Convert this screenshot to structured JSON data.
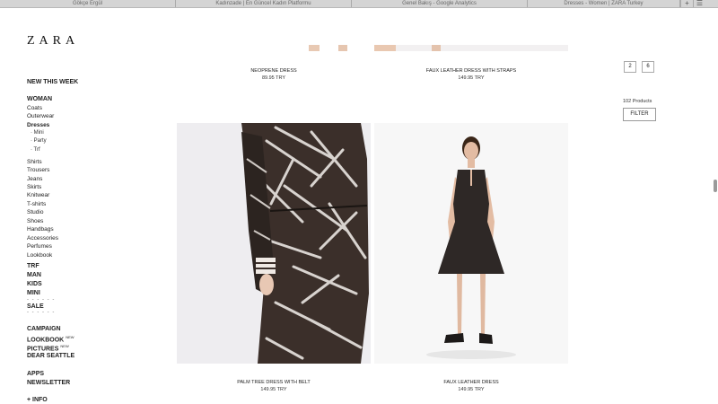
{
  "browser": {
    "tabs": [
      "Gökçe Ergül",
      "Kadınzade | En Güncel Kadın Platformu",
      "Genel Bakış - Google Analytics",
      "Dresses - Women | ZARA Turkey"
    ],
    "new_tab": "+",
    "tab_list": "☰"
  },
  "logo": "ZARA",
  "sidebar": {
    "new_this_week": "NEW THIS WEEK",
    "woman": "WOMAN",
    "items": [
      "Coats",
      "Outerwear",
      "Dresses"
    ],
    "dress_sub": [
      "· Mini",
      "· Party",
      "· Trf"
    ],
    "items2": [
      "Shirts",
      "Trousers",
      "Jeans",
      "Skirts",
      "Knitwear",
      "T-shirts",
      "Studio",
      "Shoes",
      "Handbags",
      "Accessories",
      "Perfumes",
      "Lookbook"
    ],
    "trf": "TRF",
    "man": "MAN",
    "kids": "KIDS",
    "mini": "MINI",
    "sale": "SALE",
    "campaign": "CAMPAIGN",
    "lookbook": "LOOKBOOK",
    "lookbook_badge": "NEW",
    "pictures": "PICTURES",
    "pictures_badge": "NEW",
    "dear_seattle": "DEAR SEATTLE",
    "apps": "APPS",
    "newsletter": "NEWSLETTER",
    "info": "+ INFO",
    "dashes": "- - - - - -"
  },
  "products": [
    {
      "name": "NEOPRENE DRESS",
      "price": "89.95 TRY"
    },
    {
      "name": "FAUX LEATHER DRESS WITH STRAPS",
      "price": "149.95 TRY"
    },
    {
      "name": "PALM TREE DRESS WITH BELT",
      "price": "149.95 TRY"
    },
    {
      "name": "FAUX LEATHER DRESS",
      "price": "149.95 TRY"
    }
  ],
  "controls": {
    "view_2": "2",
    "view_6": "6",
    "count": "102 Products",
    "filter": "FILTER"
  }
}
